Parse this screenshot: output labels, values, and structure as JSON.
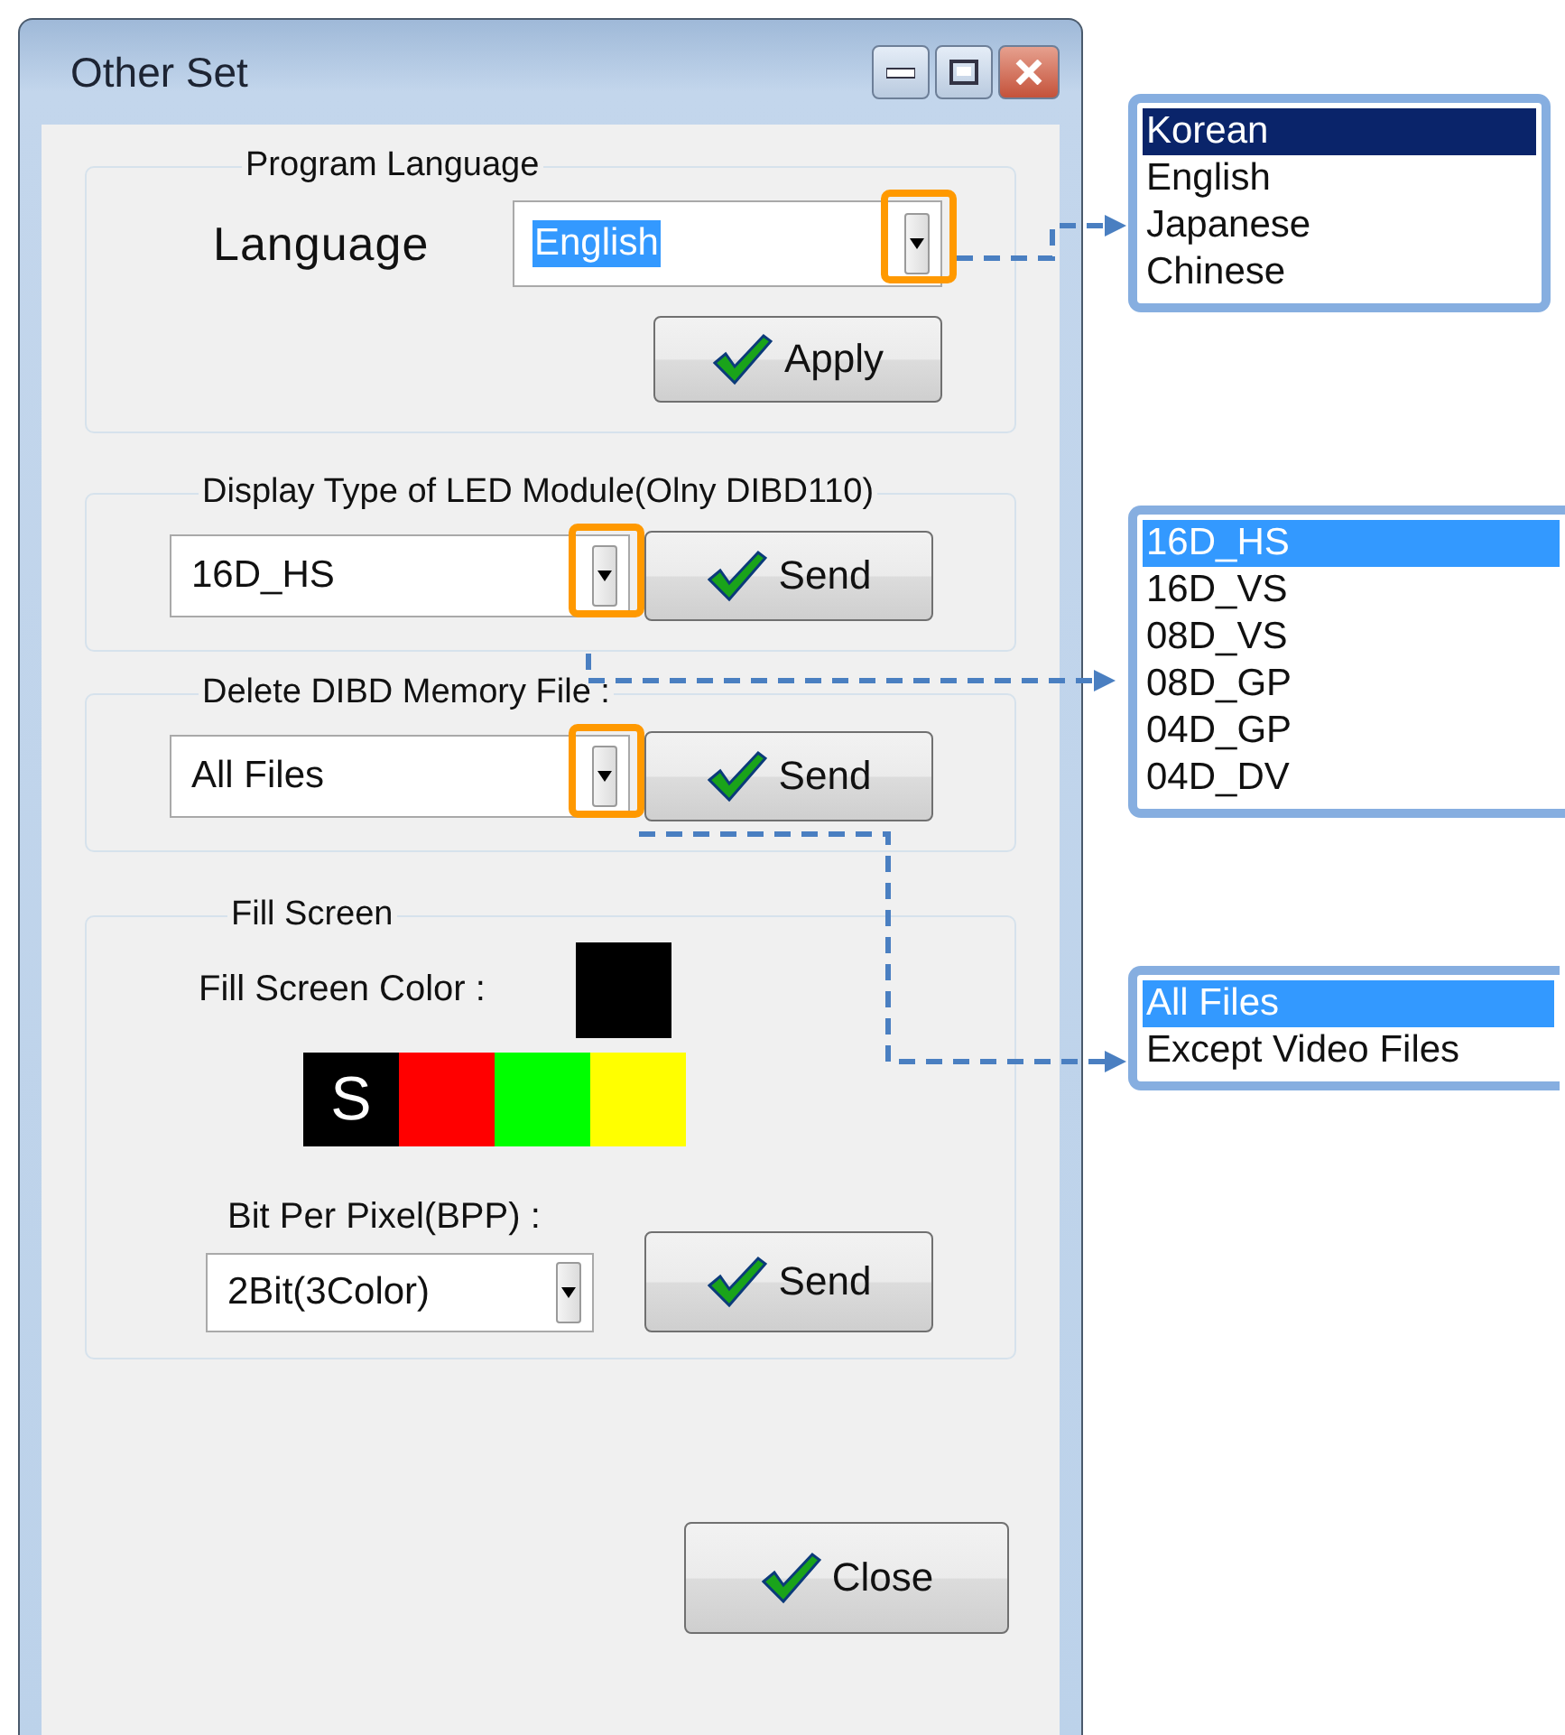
{
  "window": {
    "title": "Other Set"
  },
  "program_language": {
    "title": "Program Language",
    "label": "Language",
    "combo": {
      "value": "English",
      "text_selected": true,
      "highlighted": true
    },
    "button": "Apply"
  },
  "display_type": {
    "title": "Display Type of LED Module(Olny DIBD110)",
    "combo": {
      "value": "16D_HS",
      "text_selected": false,
      "highlighted": true
    },
    "button": "Send"
  },
  "delete_memory": {
    "title": "Delete DIBD Memory File :",
    "combo": {
      "value": "All Files",
      "text_selected": false,
      "highlighted": true
    },
    "button": "Send"
  },
  "fill_screen": {
    "title": "Fill Screen",
    "color_label": "Fill Screen Color :",
    "current": {
      "color": "#000000"
    },
    "selected_marker": "S",
    "palette": [
      {
        "color": "#000000",
        "selected": true
      },
      {
        "color": "#ff0000",
        "selected": false
      },
      {
        "color": "#00ff00",
        "selected": false
      },
      {
        "color": "#ffff00",
        "selected": false
      }
    ],
    "bpp_label": "Bit Per Pixel(BPP) :",
    "combo": {
      "value": "2Bit(3Color)",
      "text_selected": false
    },
    "button": "Send"
  },
  "close_button": "Close",
  "callout_lists": [
    {
      "kind": "classic",
      "items": [
        {
          "label": "Korean",
          "selected": true
        },
        {
          "label": "English",
          "selected": false
        },
        {
          "label": "Japanese",
          "selected": false
        },
        {
          "label": "Chinese",
          "selected": false
        }
      ]
    },
    {
      "kind": "aero",
      "items": [
        {
          "label": "16D_HS",
          "selected": true
        },
        {
          "label": "16D_VS",
          "selected": false
        },
        {
          "label": "08D_VS",
          "selected": false
        },
        {
          "label": "08D_GP",
          "selected": false
        },
        {
          "label": "04D_GP",
          "selected": false
        },
        {
          "label": "04D_DV",
          "selected": false
        }
      ]
    },
    {
      "kind": "aero",
      "items": [
        {
          "label": "All Files",
          "selected": true
        },
        {
          "label": "Except Video Files",
          "selected": false
        }
      ]
    }
  ]
}
